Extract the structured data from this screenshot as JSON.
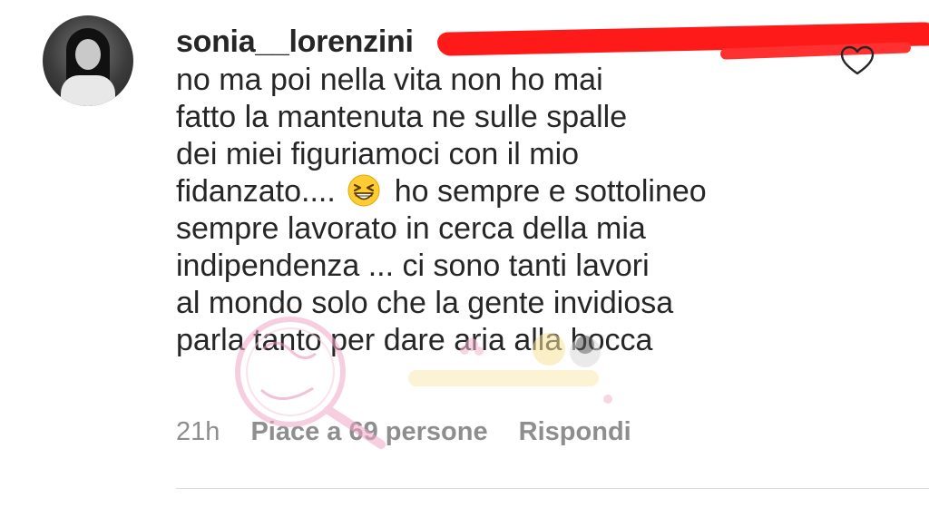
{
  "comment": {
    "username": "sonia__lorenzini",
    "lines": [
      "no ma poi nella vita non ho mai",
      "fatto la mantenuta ne sulle spalle",
      "dei miei figuriamoci con il mio",
      "fidanzato....",
      "ho sempre e sottolineo",
      "sempre lavorato in cerca della mia",
      "indipendenza ... ci sono tanti lavori",
      "al mondo solo che la gente invidiosa",
      "parla tanto per dare aria alla bocca"
    ],
    "emoji": "grinning-squinting-face"
  },
  "meta": {
    "time": "21h",
    "likes": "Piace a 69 persone",
    "reply": "Rispondi"
  },
  "icons": {
    "like": "heart-outline-icon"
  },
  "colors": {
    "text": "#262626",
    "secondary": "#8e8e8e",
    "redaction": "#ff1a1a"
  }
}
